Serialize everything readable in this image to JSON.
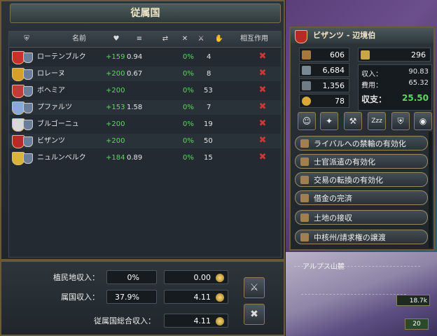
{
  "window": {
    "title": "従属国"
  },
  "table": {
    "headers": [
      "名前",
      "相互作用"
    ],
    "rows": [
      {
        "name": "ローテンブルク",
        "income": "+159",
        "ratio": "0.94",
        "pct": "0%",
        "count": "4",
        "shield_color": "#c9302c"
      },
      {
        "name": "ロレーヌ",
        "income": "+200",
        "ratio": "0.67",
        "pct": "0%",
        "count": "8",
        "shield_color": "#d4a02a"
      },
      {
        "name": "ボヘミア",
        "income": "+200",
        "ratio": "",
        "pct": "0%",
        "count": "53",
        "shield_color": "#c23b3b"
      },
      {
        "name": "プファルツ",
        "income": "+153",
        "ratio": "1.58",
        "pct": "0%",
        "count": "7",
        "shield_color": "#8aa8d8"
      },
      {
        "name": "ブルゴーニュ",
        "income": "+200",
        "ratio": "",
        "pct": "0%",
        "count": "19",
        "shield_color": "#d8d8d8"
      },
      {
        "name": "ビザンツ",
        "income": "+200",
        "ratio": "",
        "pct": "0%",
        "count": "50",
        "shield_color": "#b82a2a"
      },
      {
        "name": "ニュルンベルク",
        "income": "+184",
        "ratio": "0.89",
        "pct": "0%",
        "count": "15",
        "shield_color": "#d8b43a"
      }
    ]
  },
  "bottom": {
    "colonial_label": "植民地収入：",
    "colonial_pct": "0%",
    "colonial_value": "0.00",
    "vassal_label": "属国収入：",
    "vassal_pct": "37.9%",
    "vassal_value": "4.11",
    "total_label": "従属国総合収入：",
    "total_value": "4.11"
  },
  "detail": {
    "title": "ビザンツ - 辺境伯",
    "stats_left": [
      "606",
      "6,684",
      "1,356",
      "78"
    ],
    "stat_right_top": "296",
    "income_label": "収入：",
    "income_value": "90.83",
    "expense_label": "費用：",
    "expense_value": "65.32",
    "balance_label": "収支：",
    "balance_value": "25.50",
    "actions": [
      "ライバルへの禁輸の有効化",
      "士官派遣の有効化",
      "交易の転換の有効化",
      "借金の完済",
      "土地の接収",
      "中核州/請求権の譲渡"
    ]
  },
  "map": {
    "label_1": "アルプス山麓",
    "counter_top": "18.7k",
    "counter_bottom": "20"
  },
  "colors": {
    "green": "#5fd65f",
    "gold": "#e6c25a",
    "border": "#6a5a38"
  }
}
